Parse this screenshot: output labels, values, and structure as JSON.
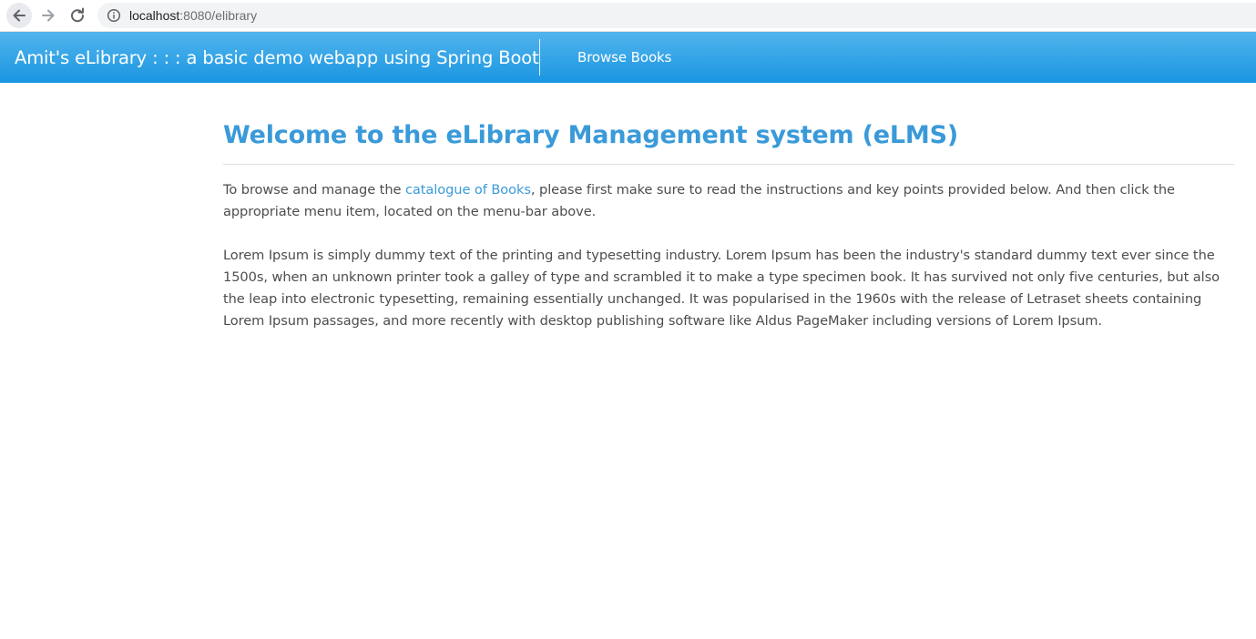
{
  "browser": {
    "url_host": "localhost",
    "url_path": ":8080/elibrary",
    "icons": [
      "back-arrow-icon",
      "forward-arrow-icon",
      "reload-icon",
      "info-icon"
    ]
  },
  "navbar": {
    "brand": "Amit's eLibrary : : : a basic demo webapp using Spring Boot",
    "links": [
      {
        "label": "Browse Books"
      }
    ],
    "colors": {
      "top": "#52b4ec",
      "bottom": "#1a96e2"
    }
  },
  "main": {
    "title": "Welcome to the eLibrary Management system (eLMS)",
    "intro": {
      "before_link": "To browse and manage the ",
      "link_text": "catalogue of Books",
      "after_link": ", please first make sure to read the instructions and key points provided below. And then click the appropriate menu item, located on the menu-bar above."
    },
    "lorem": "Lorem Ipsum is simply dummy text of the printing and typesetting industry. Lorem Ipsum has been the industry's standard dummy text ever since the 1500s, when an unknown printer took a galley of type and scrambled it to make a type specimen book. It has survived not only five centuries, but also the leap into electronic typesetting, remaining essentially unchanged. It was popularised in the 1960s with the release of Letraset sheets containing Lorem Ipsum passages, and more recently with desktop publishing software like Aldus PageMaker including versions of Lorem Ipsum."
  },
  "colors": {
    "accent": "#3a9ad9",
    "text": "#4d4d4d"
  }
}
